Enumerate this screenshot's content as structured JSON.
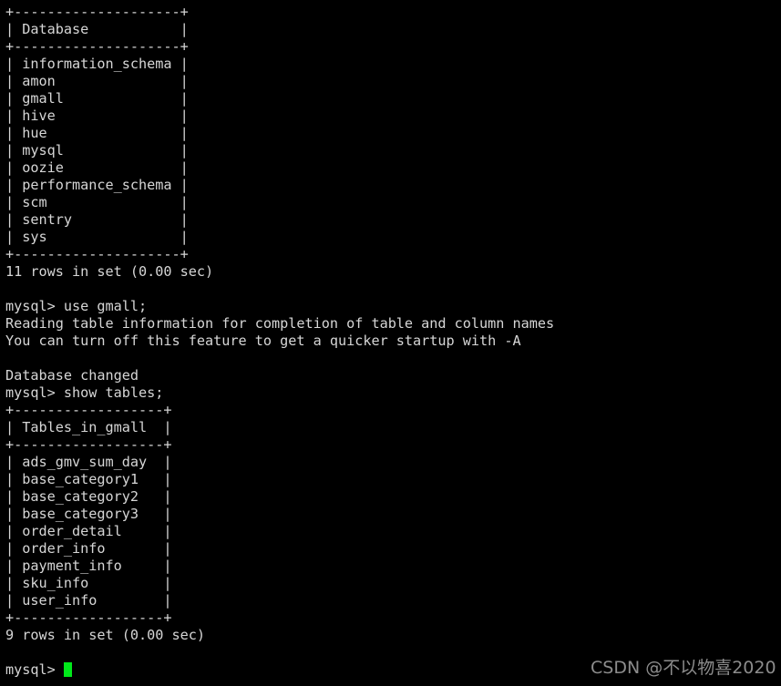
{
  "terminal": {
    "prompt": "mysql> ",
    "colors": {
      "background": "#000000",
      "foreground": "#d6d6d6",
      "cursor": "#00e81a",
      "watermark": "#8c8c8c"
    },
    "lines": [
      "+--------------------+",
      "| Database           |",
      "+--------------------+",
      "| information_schema |",
      "| amon               |",
      "| gmall              |",
      "| hive               |",
      "| hue                |",
      "| mysql              |",
      "| oozie              |",
      "| performance_schema |",
      "| scm                |",
      "| sentry             |",
      "| sys                |",
      "+--------------------+",
      "11 rows in set (0.00 sec)",
      "",
      "mysql> use gmall;",
      "Reading table information for completion of table and column names",
      "You can turn off this feature to get a quicker startup with -A",
      "",
      "Database changed",
      "mysql> show tables;",
      "+------------------+",
      "| Tables_in_gmall  |",
      "+------------------+",
      "| ads_gmv_sum_day  |",
      "| base_category1   |",
      "| base_category2   |",
      "| base_category3   |",
      "| order_detail     |",
      "| order_info       |",
      "| payment_info     |",
      "| sku_info         |",
      "| user_info        |",
      "+------------------+",
      "9 rows in set (0.00 sec)",
      ""
    ],
    "commands": [
      "use gmall;",
      "show tables;"
    ],
    "databases_result": {
      "column_header": "Database",
      "rows": [
        "information_schema",
        "amon",
        "gmall",
        "hive",
        "hue",
        "mysql",
        "oozie",
        "performance_schema",
        "scm",
        "sentry",
        "sys"
      ],
      "status": "11 rows in set (0.00 sec)"
    },
    "tables_result": {
      "column_header": "Tables_in_gmall",
      "rows": [
        "ads_gmv_sum_day",
        "base_category1",
        "base_category2",
        "base_category3",
        "order_detail",
        "order_info",
        "payment_info",
        "sku_info",
        "user_info"
      ],
      "status": "9 rows in set (0.00 sec)"
    },
    "messages": [
      "Reading table information for completion of table and column names",
      "You can turn off this feature to get a quicker startup with -A",
      "Database changed"
    ]
  },
  "watermark": {
    "text": "CSDN @不以物喜2020"
  }
}
